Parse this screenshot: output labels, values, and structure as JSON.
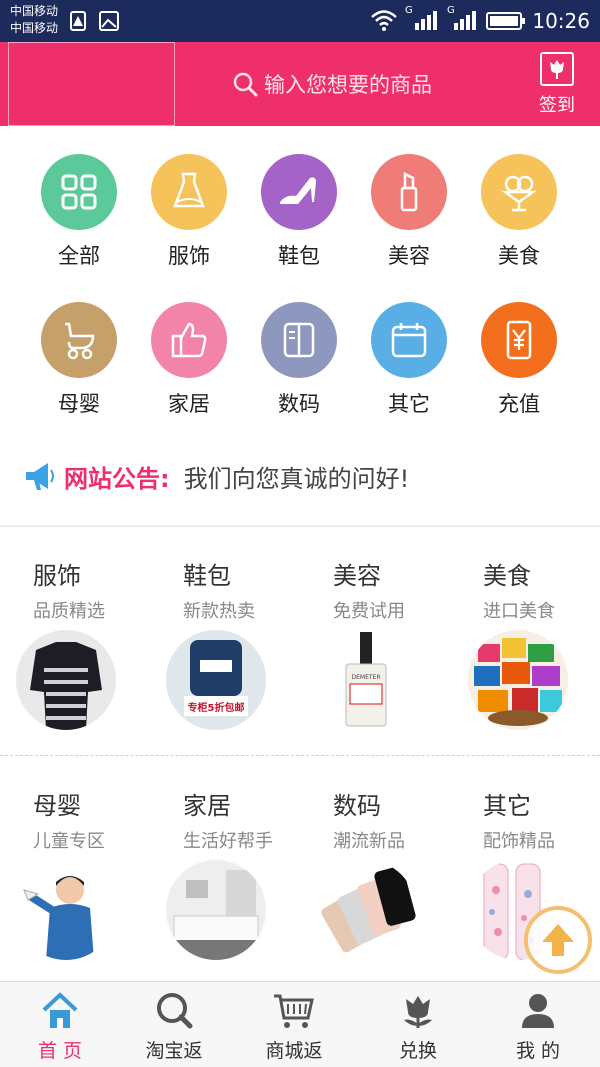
{
  "status_bar": {
    "carrier_1": "中国移动",
    "carrier_2": "中国移动",
    "time": "10:26",
    "signal_1_label": "G",
    "signal_2_label": "G"
  },
  "header": {
    "search_placeholder": "输入您想要的商品",
    "signin_label": "签到"
  },
  "categories": [
    {
      "label": "全部",
      "color": "#5cc99a",
      "icon": "grid-icon"
    },
    {
      "label": "服饰",
      "color": "#f6c35a",
      "icon": "dress-icon"
    },
    {
      "label": "鞋包",
      "color": "#a463c6",
      "icon": "high-heel-icon"
    },
    {
      "label": "美容",
      "color": "#f07c78",
      "icon": "lipstick-icon"
    },
    {
      "label": "美食",
      "color": "#f6c35a",
      "icon": "ice-cream-icon"
    },
    {
      "label": "母婴",
      "color": "#c5a06b",
      "icon": "stroller-icon"
    },
    {
      "label": "家居",
      "color": "#f284a9",
      "icon": "thumbs-up-icon"
    },
    {
      "label": "数码",
      "color": "#8e97bd",
      "icon": "device-icon"
    },
    {
      "label": "其它",
      "color": "#5aaee6",
      "icon": "calendar-icon"
    },
    {
      "label": "充值",
      "color": "#f36f1d",
      "icon": "yen-phone-icon"
    }
  ],
  "notice": {
    "title": "网站公告:",
    "message": "我们向您真诚的问好!"
  },
  "featured": [
    {
      "title": "服饰",
      "subtitle": "品质精选"
    },
    {
      "title": "鞋包",
      "subtitle": "新款热卖"
    },
    {
      "title": "美容",
      "subtitle": "免费试用"
    },
    {
      "title": "美食",
      "subtitle": "进口美食"
    },
    {
      "title": "母婴",
      "subtitle": "儿童专区"
    },
    {
      "title": "家居",
      "subtitle": "生活好帮手"
    },
    {
      "title": "数码",
      "subtitle": "潮流新品"
    },
    {
      "title": "其它",
      "subtitle": "配饰精品"
    }
  ],
  "product_image_text": {
    "bag_tag": "专柜5折包邮",
    "perfume_brand": "DEMETER"
  },
  "bottom_nav": [
    {
      "label": "首 页",
      "icon": "home-icon",
      "active": true
    },
    {
      "label": "淘宝返",
      "icon": "taobao-search-icon",
      "active": false
    },
    {
      "label": "商城返",
      "icon": "cart-icon",
      "active": false
    },
    {
      "label": "兑换",
      "icon": "tulip-icon",
      "active": false
    },
    {
      "label": "我 的",
      "icon": "user-icon",
      "active": false
    }
  ],
  "colors": {
    "brand": "#ee2f6c",
    "statusbar": "#1c2a5c"
  }
}
